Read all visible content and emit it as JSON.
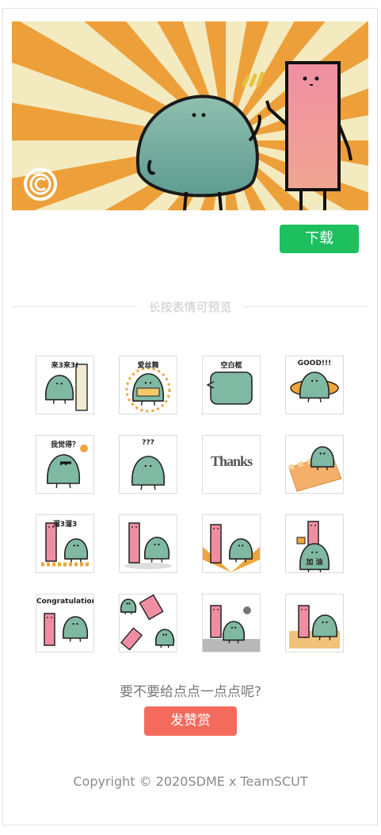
{
  "banner": {
    "logo": "copyright-c-logo"
  },
  "actions": {
    "download_label": "下载"
  },
  "preview": {
    "divider_text": "长按表情可预览"
  },
  "stickers": [
    {
      "caption": "来3来3!",
      "icon": "door-blob-sticker"
    },
    {
      "caption": "爱丝舞",
      "icon": "sparkle-blob-sticker"
    },
    {
      "caption": "空白框",
      "icon": "speech-bubble-sticker"
    },
    {
      "caption": "GOOD!!!",
      "icon": "good-ring-sticker"
    },
    {
      "caption": "我觉得？",
      "icon": "thinking-blob-sticker"
    },
    {
      "caption": "???",
      "icon": "confused-blob-sticker"
    },
    {
      "caption": "Thanks",
      "icon": "thanks-text-sticker"
    },
    {
      "caption": "",
      "icon": "blanket-blob-sticker"
    },
    {
      "caption": "溜3溜3",
      "icon": "run-away-sticker"
    },
    {
      "caption": "",
      "icon": "handshake-sticker"
    },
    {
      "caption": "",
      "icon": "sunburst-duo-sticker"
    },
    {
      "caption": "加 油",
      "icon": "cheer-sign-sticker"
    },
    {
      "caption": "Congratulations",
      "icon": "congrats-duo-sticker"
    },
    {
      "caption": "",
      "icon": "falling-duo-sticker"
    },
    {
      "caption": "",
      "icon": "sad-rain-sticker"
    },
    {
      "caption": "",
      "icon": "celebrate-duo-sticker"
    }
  ],
  "reward": {
    "question": "要不要给点点一点点呢?",
    "button_label": "发赞赏"
  },
  "footer": {
    "copyright": "Copyright © 2020SDME x TeamSCUT"
  },
  "colors": {
    "green": "#1dbf5e",
    "coral": "#f46b5d",
    "blob": "#7fb8a3",
    "pink": "#ef8ea2",
    "orange": "#f0a43a"
  }
}
